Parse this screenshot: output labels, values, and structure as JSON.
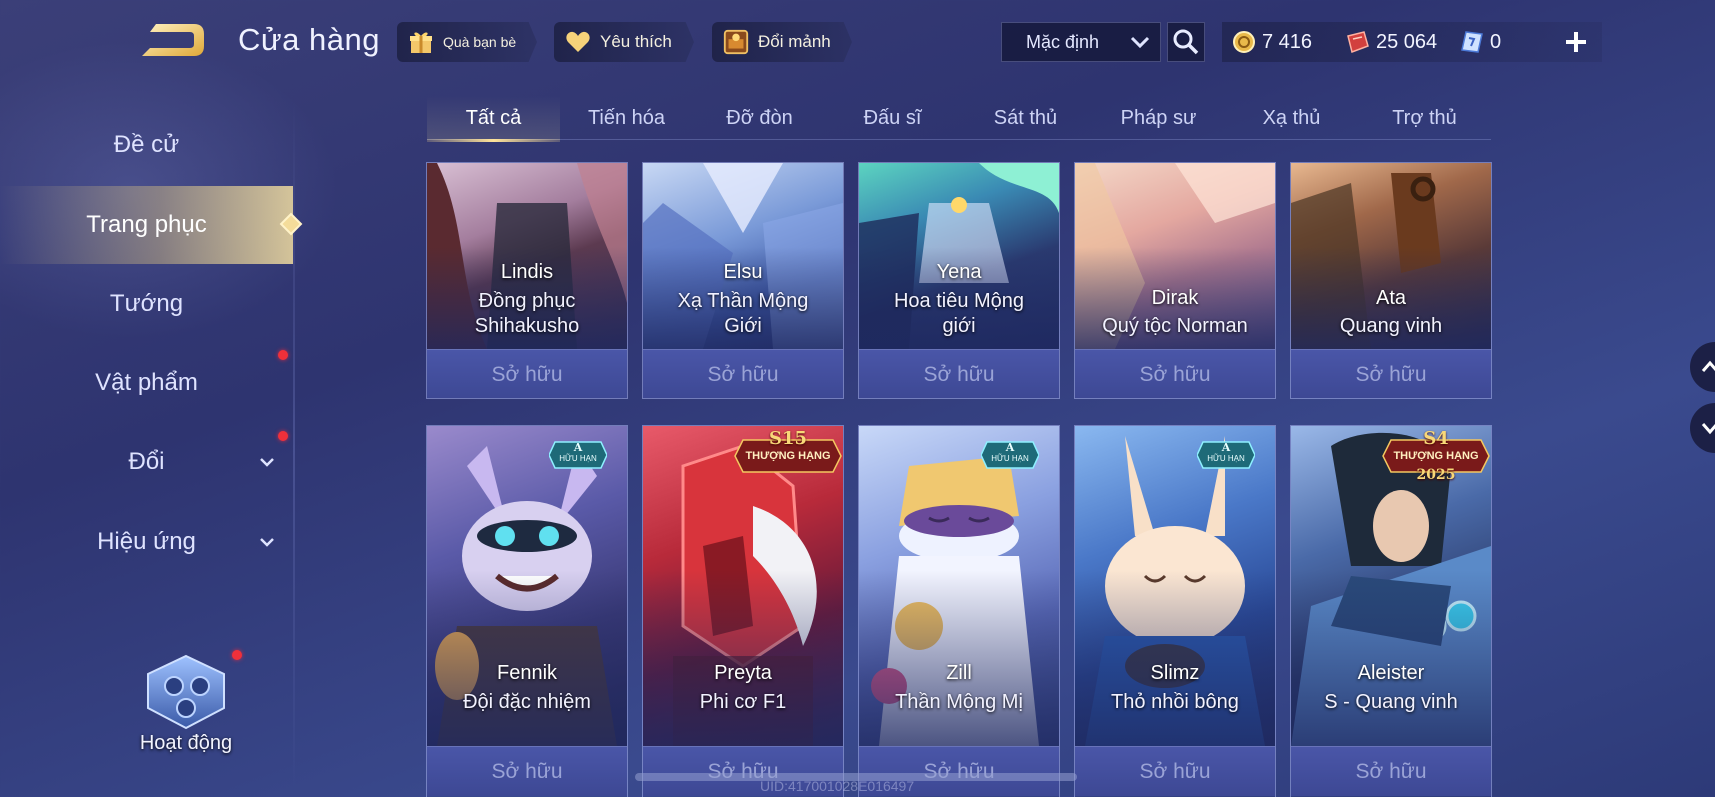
{
  "header": {
    "title": "Cửa hàng",
    "friend_gift_label": "Quà bạn bè",
    "favorites_label": "Yêu thích",
    "exchange_label": "Đổi mảnh",
    "sort_value": "Mặc định",
    "currencies": [
      {
        "icon": "gold-coin-icon",
        "value": "7 416"
      },
      {
        "icon": "red-voucher-icon",
        "value": "25 064"
      },
      {
        "icon": "blue-ticket-icon",
        "value": "0"
      }
    ]
  },
  "sidebar": {
    "items": [
      {
        "label": "Đề cử",
        "active": false,
        "dot": false,
        "expandable": false
      },
      {
        "label": "Trang phục",
        "active": true,
        "dot": false,
        "expandable": false
      },
      {
        "label": "Tướng",
        "active": false,
        "dot": false,
        "expandable": false
      },
      {
        "label": "Vật phẩm",
        "active": false,
        "dot": true,
        "expandable": false
      },
      {
        "label": "Đổi",
        "active": false,
        "dot": true,
        "expandable": true
      },
      {
        "label": "Hiệu ứng",
        "active": false,
        "dot": false,
        "expandable": true
      }
    ],
    "activity_label": "Hoạt động"
  },
  "tabs": [
    "Tất cả",
    "Tiến hóa",
    "Đỡ đòn",
    "Đấu sĩ",
    "Sát thủ",
    "Pháp sư",
    "Xạ thủ",
    "Trợ thủ"
  ],
  "active_tab": 0,
  "skins_row1": [
    {
      "hero": "Lindis",
      "skin_lines": [
        "Đồng phục",
        "Shihakusho"
      ],
      "status": "Sở hữu"
    },
    {
      "hero": "Elsu",
      "skin_lines": [
        "Xạ Thần Mộng",
        "Giới"
      ],
      "status": "Sở hữu"
    },
    {
      "hero": "Yena",
      "skin_lines": [
        "Hoa tiêu Mộng",
        "giới"
      ],
      "status": "Sở hữu"
    },
    {
      "hero": "Dirak",
      "skin_lines": [
        "Quý tộc Norman"
      ],
      "status": "Sở hữu"
    },
    {
      "hero": "Ata",
      "skin_lines": [
        "Quang vinh"
      ],
      "status": "Sở hữu"
    }
  ],
  "skins_row2": [
    {
      "hero": "Fennik",
      "skin_lines": [
        "Đội đặc nhiệm"
      ],
      "status": "Sở hữu",
      "badge": {
        "type": "A",
        "top": "A",
        "bottom": "HỮU HẠN"
      }
    },
    {
      "hero": "Preyta",
      "skin_lines": [
        "Phi cơ F1"
      ],
      "status": "Sở hữu",
      "badge": {
        "type": "S",
        "top": "S15",
        "bottom": "THƯỢNG HẠNG"
      }
    },
    {
      "hero": "Zill",
      "skin_lines": [
        "Thần Mộng Mị"
      ],
      "status": "Sở hữu",
      "badge": {
        "type": "A",
        "top": "A",
        "bottom": "HỮU HẠN"
      }
    },
    {
      "hero": "Slimz",
      "skin_lines": [
        "Thỏ nhồi bông"
      ],
      "status": "Sở hữu",
      "badge": {
        "type": "A",
        "top": "A",
        "bottom": "HỮU HẠN"
      }
    },
    {
      "hero": "Aleister",
      "skin_lines": [
        "S - Quang vinh"
      ],
      "status": "Sở hữu",
      "badge": {
        "type": "S",
        "top": "S4",
        "bottom": "THƯỢNG HẠNG",
        "year": "2025"
      }
    }
  ],
  "footer": {
    "uid": "UID:417001028E016497"
  },
  "colors": {
    "accent_gold": "#ffe49a",
    "owned_bg": "#4a56a8",
    "notify_red": "#f0303a",
    "background": "#2e3470"
  }
}
